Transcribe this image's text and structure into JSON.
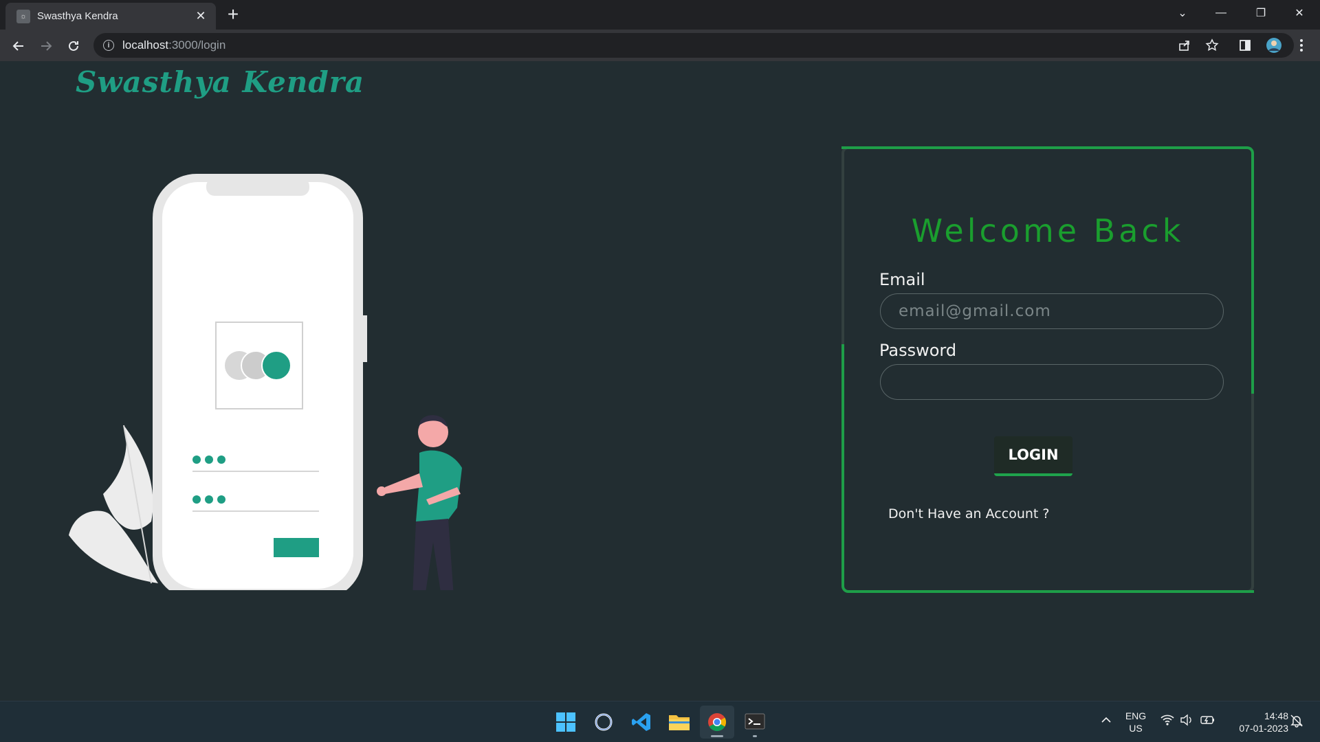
{
  "browser": {
    "tab_title": "Swasthya Kendra",
    "tab_close": "✕",
    "new_tab": "+",
    "url_host": "localhost",
    "url_path": ":3000/login",
    "window_controls": {
      "tab_search": "⌄",
      "minimize": "—",
      "restore": "❐",
      "close": "✕"
    }
  },
  "page": {
    "brand": "Swasthya Kendra",
    "login": {
      "title": "Welcome Back",
      "email_label": "Email",
      "email_placeholder": "email@gmail.com",
      "email_value": "",
      "password_label": "Password",
      "password_value": "",
      "login_button": "LOGIN",
      "signup_link": "Don't Have an Account ?"
    }
  },
  "taskbar": {
    "language": "ENG",
    "region": "US",
    "time": "14:48",
    "date": "07-01-2023"
  },
  "colors": {
    "page_bg": "#222d31",
    "brand": "#1f9e84",
    "welcome": "#1a9e2e",
    "accent_green": "#1e9e48",
    "illustration_teal": "#1f9e84"
  },
  "icons": [
    "back-arrow-icon",
    "forward-arrow-icon",
    "reload-icon",
    "info-icon",
    "share-icon",
    "star-icon",
    "sidepanel-icon",
    "profile-avatar-icon",
    "kebab-menu-icon",
    "windows-start-icon",
    "cortana-icon",
    "vscode-icon",
    "file-explorer-icon",
    "chrome-icon",
    "terminal-icon",
    "chevron-up-icon",
    "wifi-icon",
    "volume-icon",
    "battery-icon",
    "notification-icon"
  ]
}
